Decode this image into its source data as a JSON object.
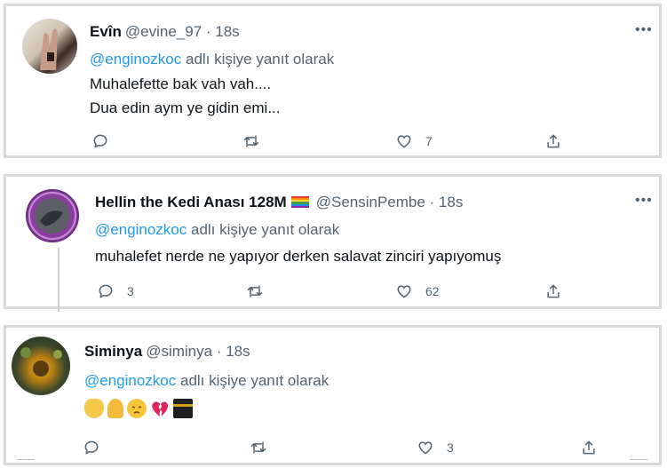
{
  "colors": {
    "link": "#1d9bf0",
    "secondary_text": "#536471",
    "frame": "#d9d9d9"
  },
  "tweets": [
    {
      "name": "Evîn",
      "handle": "@evine_97 · 18s",
      "reply_mention": "@enginozkoc",
      "reply_suffix": " adlı kişiye yanıt olarak",
      "lines": [
        "Muhalefette bak vah vah....",
        "Dua edin aym ye gidin emi..."
      ],
      "more_icon": "more-icon",
      "actions": {
        "reply_count": "",
        "retweet_count": "",
        "like_count": "7"
      }
    },
    {
      "name": "Hellin the Kedi Anası 128M",
      "handle": "@SensinPembe · 18s",
      "badge_icon": "rainbow-flag-icon",
      "reply_mention": "@enginozkoc",
      "reply_suffix": " adlı kişiye yanıt olarak",
      "lines": [
        "muhalefet nerde ne yapıyor derken salavat zinciri yapıyomuş"
      ],
      "more_icon": "more-icon",
      "actions": {
        "reply_count": "3",
        "retweet_count": "",
        "like_count": "62"
      }
    },
    {
      "name": "Siminya",
      "handle": "@siminya · 18s",
      "reply_mention": "@enginozkoc",
      "reply_suffix": " adlı kişiye yanıt olarak",
      "emojis": [
        "open-hands-emoji",
        "folded-hands-emoji",
        "pensive-face-emoji",
        "broken-heart-emoji",
        "kaaba-emoji"
      ],
      "actions": {
        "reply_count": "",
        "retweet_count": "",
        "like_count": "3"
      }
    }
  ]
}
